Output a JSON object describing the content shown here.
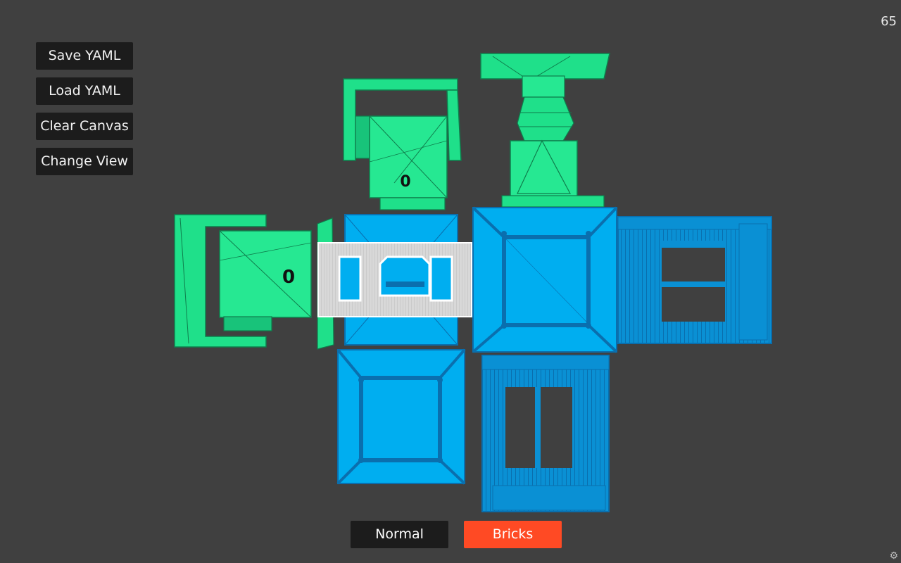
{
  "app": {
    "fps": "65"
  },
  "sidebar": {
    "buttons": [
      {
        "label": "Save YAML"
      },
      {
        "label": "Load YAML"
      },
      {
        "label": "Clear Canvas"
      },
      {
        "label": "Change View"
      }
    ]
  },
  "modes": {
    "normal_label": "Normal",
    "bricks_label": "Bricks",
    "active": "Bricks"
  },
  "scene": {
    "module_id_top": "0",
    "module_id_left": "0"
  },
  "colors": {
    "background": "#404040",
    "motor_green": "#1fe08a",
    "cube_blue": "#00aef0",
    "connector_gray": "#d4d4d4",
    "active_mode": "#ff4a24",
    "button_dark": "#1c1c1c"
  },
  "icons": {
    "settings": "gear-icon"
  }
}
